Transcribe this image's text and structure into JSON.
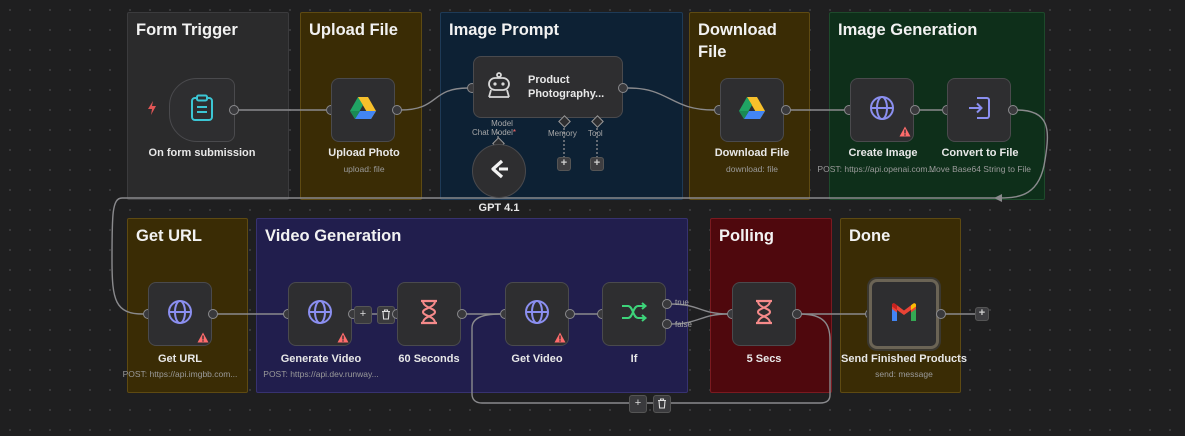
{
  "groups": {
    "form_trigger": "Form Trigger",
    "upload_file": "Upload File",
    "image_prompt": "Image Prompt",
    "download_file_1": "Download",
    "download_file_2": "File",
    "image_generation": "Image Generation",
    "get_url": "Get URL",
    "video_generation": "Video Generation",
    "polling": "Polling",
    "done": "Done"
  },
  "nodes": {
    "form_submission": {
      "label": "On form submission"
    },
    "upload_photo": {
      "label": "Upload Photo",
      "sub": "upload: file"
    },
    "agent": {
      "label_1": "Product",
      "label_2": "Photography..."
    },
    "agent_ports": {
      "model_1": "Model",
      "model_2": "Chat Model",
      "memory": "Memory",
      "tool": "Tool"
    },
    "gpt": {
      "label": "GPT 4.1"
    },
    "download_file": {
      "label": "Download File",
      "sub": "download: file"
    },
    "create_image": {
      "label": "Create Image",
      "sub": "POST: https://api.openai.com..."
    },
    "convert_to_file": {
      "label": "Convert to File",
      "sub": "Move Base64 String to File"
    },
    "get_url": {
      "label": "Get URL",
      "sub": "POST: https://api.imgbb.com..."
    },
    "generate_video": {
      "label": "Generate Video",
      "sub": "POST: https://api.dev.runway..."
    },
    "wait_60": {
      "label": "60 Seconds"
    },
    "get_video": {
      "label": "Get Video"
    },
    "if": {
      "label": "If",
      "true_label": "true",
      "false_label": "false"
    },
    "wait_5": {
      "label": "5 Secs"
    },
    "send_products": {
      "label": "Send Finished Products",
      "sub": "send: message"
    }
  },
  "buttons": {
    "add": "+",
    "delete": "🗑"
  },
  "colors": {
    "canvas": "#1f1f20",
    "wire": "#8a8a8d",
    "form_trigger_bg": "#2b2b2c",
    "yellow_group_bg": "#3a2c05",
    "blue_group_bg": "#0d2134",
    "green_group_bg": "#0e2f1a",
    "purple_group_bg": "#211e4d",
    "red_group_bg": "#4f080d",
    "warning": "#ff6b6b",
    "webhook_icon": "#3cc6d4",
    "http_icon": "#8b8ff0",
    "wait_icon": "#f58a8a",
    "if_icon": "#3dd47a",
    "convert_icon": "#8b8ff0"
  },
  "icons": {
    "trigger": "bolt-icon",
    "form": "clipboard-icon",
    "drive": "google-drive-icon",
    "agent": "robot-icon",
    "model": "openai-chat-icon",
    "http": "globe-icon",
    "convert": "convert-to-file-icon",
    "wait": "hourglass-icon",
    "if": "branch-icon",
    "gmail": "gmail-icon",
    "warning": "warning-icon"
  }
}
